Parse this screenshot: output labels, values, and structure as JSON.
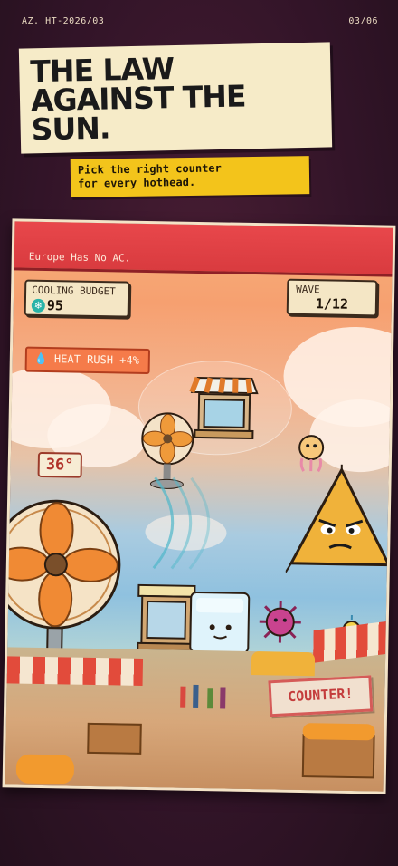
{
  "meta": {
    "issue_code": "AZ. HT-2026/03",
    "page_number": "03/06"
  },
  "headline": {
    "title": "THE LAW\nAGAINST THE\nSUN.",
    "subtitle": "Pick the right counter\nfor every hothead."
  },
  "game": {
    "banner_text": "Europe Has No AC.",
    "cooling_budget": {
      "label": "COOLING BUDGET",
      "value": "95",
      "icon": "snowflake-icon"
    },
    "wave": {
      "label": "WAVE",
      "value": "1/12"
    },
    "heat_rush": {
      "label": "HEAT RUSH +4%",
      "icon": "heat-drop-icon"
    },
    "temperature_chip": "36°",
    "counter_button": "COUNTER!",
    "units": [
      "desk-fan",
      "awning-window",
      "ice-block",
      "big-fan"
    ],
    "enemies": [
      "triangle-sun-boss",
      "jellyfish-sun",
      "spiky-virus-sun",
      "small-sun-sprite"
    ]
  },
  "colors": {
    "background": "#321428",
    "banner": "#e8474b",
    "accent_yellow": "#f3c41b",
    "title_card": "#f6ebc8"
  }
}
